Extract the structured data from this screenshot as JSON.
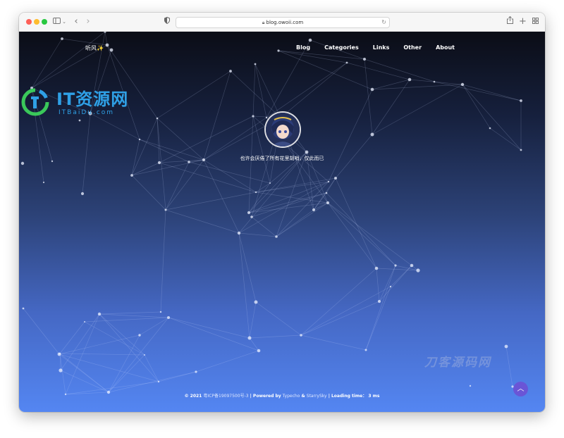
{
  "browser": {
    "url": "blog.owoii.com",
    "icons": [
      "sidebar-icon",
      "chevron-down-icon",
      "back-icon",
      "forward-icon",
      "shield-icon",
      "lock-icon",
      "reload-icon",
      "share-icon",
      "new-tab-icon",
      "tab-overview-icon"
    ]
  },
  "site": {
    "title": "听风✨",
    "nav": [
      "Blog",
      "Categories",
      "Links",
      "Other",
      "About"
    ],
    "motto": "也许会厌倦了所有花里胡哨，仅此而已"
  },
  "watermarks": {
    "logo_title": "IT资源网",
    "logo_sub": "ITBaiDu.com",
    "secondary": "刀客源码网"
  },
  "footer": {
    "year": "© 2021",
    "icp": "粤ICP备19097500号-3",
    "powered_prefix": "| Powered by",
    "typecho": "Typecho",
    "amp": "&",
    "theme": "StarrySky",
    "loading_label": "| Loading time：",
    "loading_value": "3 ms"
  },
  "colors": {
    "bg_top": "#0b0d16",
    "bg_bottom": "#5486f2",
    "back_to_top": "#6a55d6",
    "watermark_blue": "#2fa0e6"
  }
}
